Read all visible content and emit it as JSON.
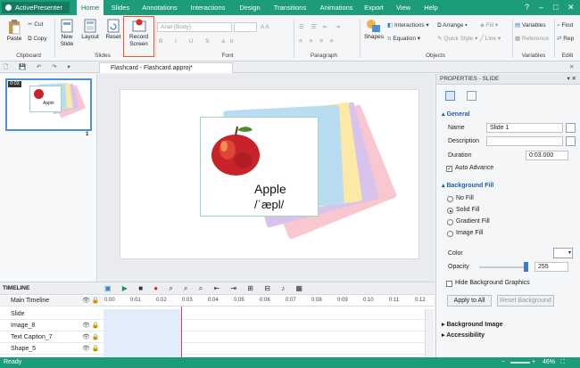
{
  "app": {
    "brand": "ActivePresenter"
  },
  "menu": {
    "tabs": [
      "Home",
      "Slides",
      "Annotations",
      "Interactions",
      "Design",
      "Transitions",
      "Animations",
      "Export",
      "View",
      "Help"
    ],
    "active": "Home"
  },
  "ribbon": {
    "clipboard": {
      "paste": "Paste",
      "cut": "Cut",
      "copy": "Copy",
      "label": "Clipboard"
    },
    "slides": {
      "new_slide": "New Slide",
      "layout": "Layout",
      "reset": "Reset",
      "label": "Slides"
    },
    "record": {
      "label": "Record Screen"
    },
    "font": {
      "family_placeholder": "Arial (Body)",
      "label": "Font"
    },
    "paragraph": {
      "label": "Paragraph"
    },
    "objects": {
      "shapes": "Shapes",
      "interactions": "Interactions",
      "equation": "Equation",
      "arrange": "Arrange",
      "quick_style": "Quick Style",
      "fill": "Fill",
      "line": "Line",
      "label": "Objects"
    },
    "variables": {
      "variables": "Variables",
      "reference": "Reference",
      "label": "Variables"
    },
    "editing": {
      "find": "Find",
      "replace": "Rep",
      "label": "Editi"
    }
  },
  "document": {
    "tab_title": "Flashcard - Flashcard.approj*"
  },
  "slides_panel": {
    "thumb_badge": "0:03",
    "thumb_number": "1",
    "thumb_word": "Apple"
  },
  "slide": {
    "word": "Apple",
    "phonetic": "/ˈæpl/",
    "card_colors": [
      "#f9c7cf",
      "#d7c3ec",
      "#fde9a6",
      "#b9dcf2"
    ]
  },
  "properties": {
    "header": "PROPERTIES - SLIDE",
    "general": {
      "title": "General",
      "name_label": "Name",
      "name_value": "Slide 1",
      "description_label": "Description",
      "description_value": "",
      "duration_label": "Duration",
      "duration_value": "0:03.000",
      "auto_advance": "Auto Advance"
    },
    "background": {
      "title": "Background Fill",
      "options": [
        "No Fill",
        "Solid Fill",
        "Gradient Fill",
        "Image Fill"
      ],
      "selected": "Solid Fill",
      "color_label": "Color",
      "opacity_label": "Opacity",
      "opacity_value": "255",
      "opacity_level": 1.0,
      "hide_graphics": "Hide Background Graphics",
      "apply_all": "Apply to All",
      "reset_background": "Reset Background"
    },
    "collapsed": [
      "Background Image",
      "Accessibility"
    ]
  },
  "timeline": {
    "title": "TIMELINE",
    "main": "Main Timeline",
    "rows": [
      "Slide",
      "Image_8",
      "Text Caption_7",
      "Shape_5"
    ],
    "ruler": [
      "0:00",
      "0:01",
      "0:02",
      "0:03",
      "0:04",
      "0:05",
      "0:06",
      "0:07",
      "0:08",
      "0:09",
      "0:10",
      "0:11",
      "0:12"
    ]
  },
  "status": {
    "text": "Ready",
    "zoom": "46%"
  },
  "colors": {
    "accent": "#1d9c7b",
    "record_highlight": "#e8572c",
    "section": "#1f5fa8"
  }
}
